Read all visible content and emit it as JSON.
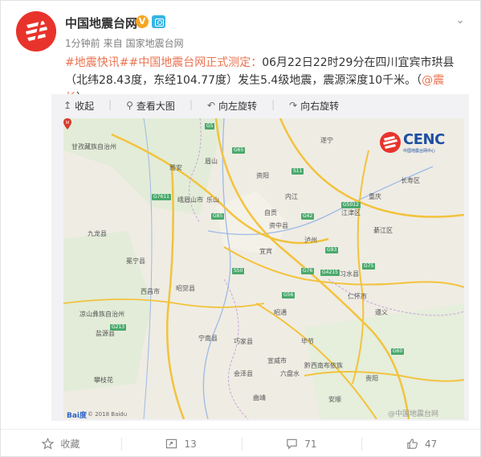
{
  "post": {
    "author": "中国地震台网",
    "verified_badge": "V",
    "time": "1分钟前",
    "source_prefix": "来自",
    "source": "国家地震台网",
    "tags": [
      "#地震快讯#",
      "#中国地震台网正式测定："
    ],
    "text": "06月22日22时29分在四川宜宾市珙县（北纬28.43度，东经104.77度）发生5.4级地震，震源深度10千米。（",
    "mention": "@震长",
    "text_end": "）"
  },
  "toolbar": {
    "collapse": "收起",
    "view_large": "查看大图",
    "rotate_left": "向左旋转",
    "rotate_right": "向右旋转"
  },
  "map": {
    "logo_main": "CENC",
    "logo_sub": "中国地震台网中心",
    "baidu": "Bai度",
    "baidu_copy": "© 2018 Baidu",
    "watermark": "@中国地震台网",
    "labels": [
      "甘孜藏族自治州",
      "雅安",
      "眉山",
      "乐山",
      "峨眉山市",
      "九龙县",
      "冕宁县",
      "西昌市",
      "昭觉县",
      "凉山彝族自治州",
      "盐源县",
      "攀枝花",
      "自贡",
      "宜宾",
      "泸州",
      "内江",
      "遂宁",
      "重庆",
      "綦江区",
      "宁南县",
      "巧家县",
      "昭通",
      "毕节",
      "遵义",
      "六盘水",
      "贵阳",
      "安顺",
      "曲靖",
      "会泽县",
      "宣威市",
      "长寿区",
      "资阳",
      "资中县",
      "江津区",
      "习水县",
      "仁怀市",
      "黔西南布依族"
    ],
    "roads": [
      "G5",
      "G85",
      "G76",
      "G65",
      "G56",
      "G75",
      "G93",
      "G42",
      "G4215",
      "S11",
      "G5012",
      "G60",
      "G7611",
      "G213",
      "S50"
    ]
  },
  "footer": {
    "favorite": "收藏",
    "repost_count": "13",
    "comment_count": "71",
    "like_count": "47"
  }
}
